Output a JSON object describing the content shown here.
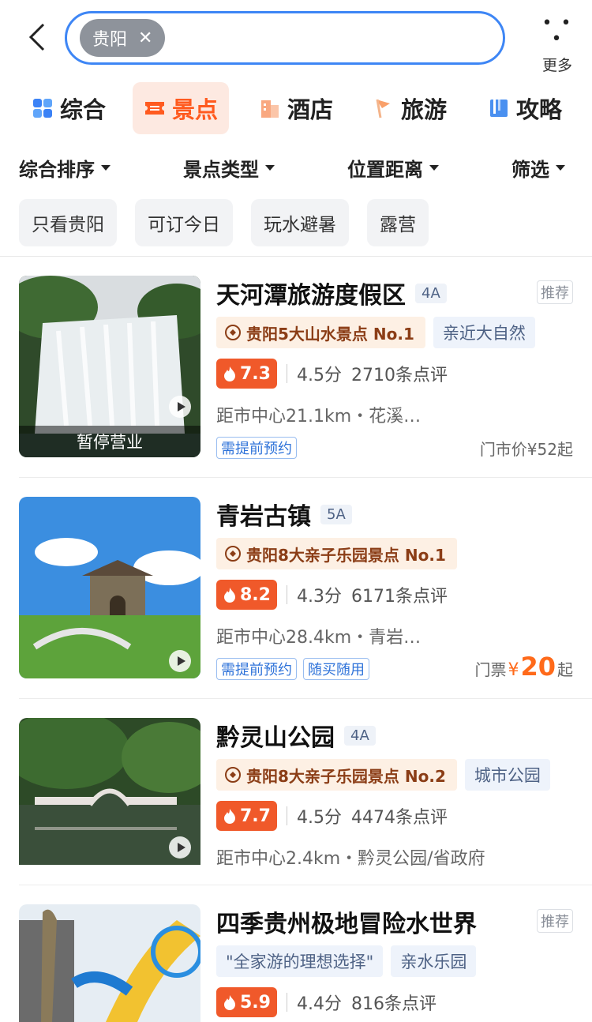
{
  "header": {
    "search_chip": "贵阳",
    "more_label": "更多"
  },
  "tabs": [
    {
      "label": "综合",
      "icon": "grid-icon",
      "active": false
    },
    {
      "label": "景点",
      "icon": "ticket-icon",
      "active": true
    },
    {
      "label": "酒店",
      "icon": "hotel-icon",
      "active": false
    },
    {
      "label": "旅游",
      "icon": "flag-icon",
      "active": false
    },
    {
      "label": "攻略",
      "icon": "book-icon",
      "active": false
    }
  ],
  "filters": [
    "综合排序",
    "景点类型",
    "位置距离",
    "筛选"
  ],
  "quick_filters": [
    "只看贵阳",
    "可订今日",
    "玩水避暑",
    "露营"
  ],
  "results": [
    {
      "name": "天河潭旅游度假区",
      "level": "4A",
      "recommend": "推荐",
      "rank_tag": "贵阳5大山水景点 No.1",
      "category": "亲近大自然",
      "score": "7.3",
      "rating": "4.5分",
      "reviews": "2710条点评",
      "distance": "距市中心21.1km・花溪…",
      "badges": [
        "需提前预约"
      ],
      "price_text": "门市价¥52起",
      "status": "暂停营业"
    },
    {
      "name": "青岩古镇",
      "level": "5A",
      "rank_tag": "贵阳8大亲子乐园景点 No.1",
      "score": "8.2",
      "rating": "4.3分",
      "reviews": "6171条点评",
      "distance": "距市中心28.4km・青岩…",
      "badges": [
        "需提前预约",
        "随买随用"
      ],
      "price_prefix": "门票",
      "price_currency": "¥",
      "price_value": "20",
      "price_suffix": "起"
    },
    {
      "name": "黔灵山公园",
      "level": "4A",
      "rank_tag": "贵阳8大亲子乐园景点 No.2",
      "category": "城市公园",
      "score": "7.7",
      "rating": "4.5分",
      "reviews": "4474条点评",
      "distance": "距市中心2.4km・黔灵公园/省政府"
    },
    {
      "name": "四季贵州极地冒险水世界",
      "recommend": "推荐",
      "quote_tag": "\"全家游的理想选择\"",
      "category": "亲水乐园",
      "score": "5.9",
      "rating": "4.4分",
      "reviews": "816条点评"
    }
  ],
  "colors": {
    "accent": "#ff5a1f",
    "search_border": "#3e86f5",
    "score_bg": "#f0592a"
  }
}
